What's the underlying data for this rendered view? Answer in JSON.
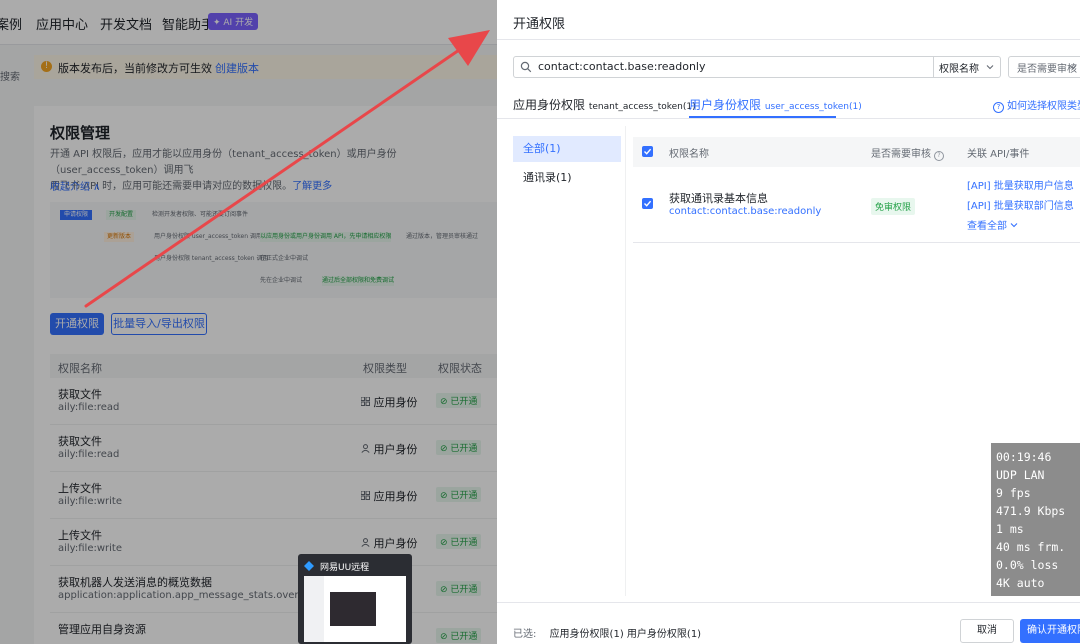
{
  "background": {
    "nav": [
      "案例",
      "应用中心",
      "开发文档",
      "智能助手"
    ],
    "ai_badge": "✦ AI 开发",
    "side_label": "搜索",
    "notice": {
      "text": "版本发布后，当前修改方可生效",
      "link": "创建版本"
    },
    "card": {
      "title": "权限管理",
      "desc_line1": "开通 API 权限后，应用才能以应用身份（tenant_access_token）或用户身份（user_access_token）调用飞",
      "desc_line2": "用飞书 API 时，应用可能还需要申请对应的数据权限。",
      "desc_link": "了解更多",
      "collapse": "收起介绍 ∧"
    },
    "diagram": {
      "items": [
        "申请权限",
        "开发配置",
        "检测开发者权限、可能还要订阅事件",
        "更新版本",
        "用户身份权限 user_access_token 调用",
        "以应用身份或用户身份调用 API，先申请相应权限",
        "通过版本，管理员审核通过",
        "用户身份权限 tenant_access_token 调用",
        "在正式企业中调试",
        "先在企业中调试",
        "通过后全部权限和免费调试"
      ]
    },
    "buttons": {
      "open": "开通权限",
      "batch": "批量导入/导出权限"
    },
    "table": {
      "headers": {
        "name": "权限名称",
        "type": "权限类型",
        "status": "权限状态"
      },
      "rows": [
        {
          "name": "获取文件",
          "scope": "aily:file:read",
          "type": "应用身份",
          "status": "已开通",
          "type_icon": "app-grid-icon"
        },
        {
          "name": "获取文件",
          "scope": "aily:file:read",
          "type": "用户身份",
          "status": "已开通",
          "type_icon": "user-icon"
        },
        {
          "name": "上传文件",
          "scope": "aily:file:write",
          "type": "应用身份",
          "status": "已开通",
          "type_icon": "app-grid-icon"
        },
        {
          "name": "上传文件",
          "scope": "aily:file:write",
          "type": "用户身份",
          "status": "已开通",
          "type_icon": "user-icon"
        },
        {
          "name": "获取机器人发送消息的概览数据",
          "scope": "application:application.app_message_stats.overview:read",
          "type": "",
          "status": "已开通",
          "type_icon": ""
        },
        {
          "name": "管理应用自身资源",
          "scope": "",
          "type": "",
          "status": "已开通",
          "type_icon": ""
        }
      ]
    },
    "popup_title": "网易UU远程"
  },
  "drawer": {
    "title": "开通权限",
    "search": {
      "value": "contact:contact.base:readonly",
      "select_label": "权限名称",
      "audit_label": "是否需要审核"
    },
    "tabs": [
      {
        "label": "应用身份权限",
        "sub": "tenant_access_token(1)"
      },
      {
        "label": "用户身份权限",
        "sub": "user_access_token(1)"
      }
    ],
    "help_link": "如何选择权限类型",
    "categories": [
      "全部(1)",
      "通讯录(1)"
    ],
    "table_headers": {
      "name": "权限名称",
      "audit": "是否需要审核",
      "api": "关联 API/事件"
    },
    "permission": {
      "name": "获取通讯录基本信息",
      "scope": "contact:contact.base:readonly",
      "badge": "免审权限",
      "apis": [
        "[API] 批量获取用户信息",
        "[API] 批量获取部门信息"
      ],
      "view_all": "查看全部"
    },
    "footer": {
      "selected_label": "已选:",
      "selected_app": "应用身份权限(1)",
      "selected_user": "用户身份权限(1)",
      "cancel": "取消",
      "confirm": "确认开通权限"
    }
  },
  "stats": [
    "00:19:46",
    "UDP LAN",
    "9 fps",
    "471.9 Kbps",
    "1 ms",
    "40 ms frm.",
    "0.0% loss",
    "4K auto"
  ],
  "colors": {
    "accent": "#3370ff",
    "success": "#24a148",
    "arrow": "#e8474a",
    "warning": "#f5a623"
  }
}
